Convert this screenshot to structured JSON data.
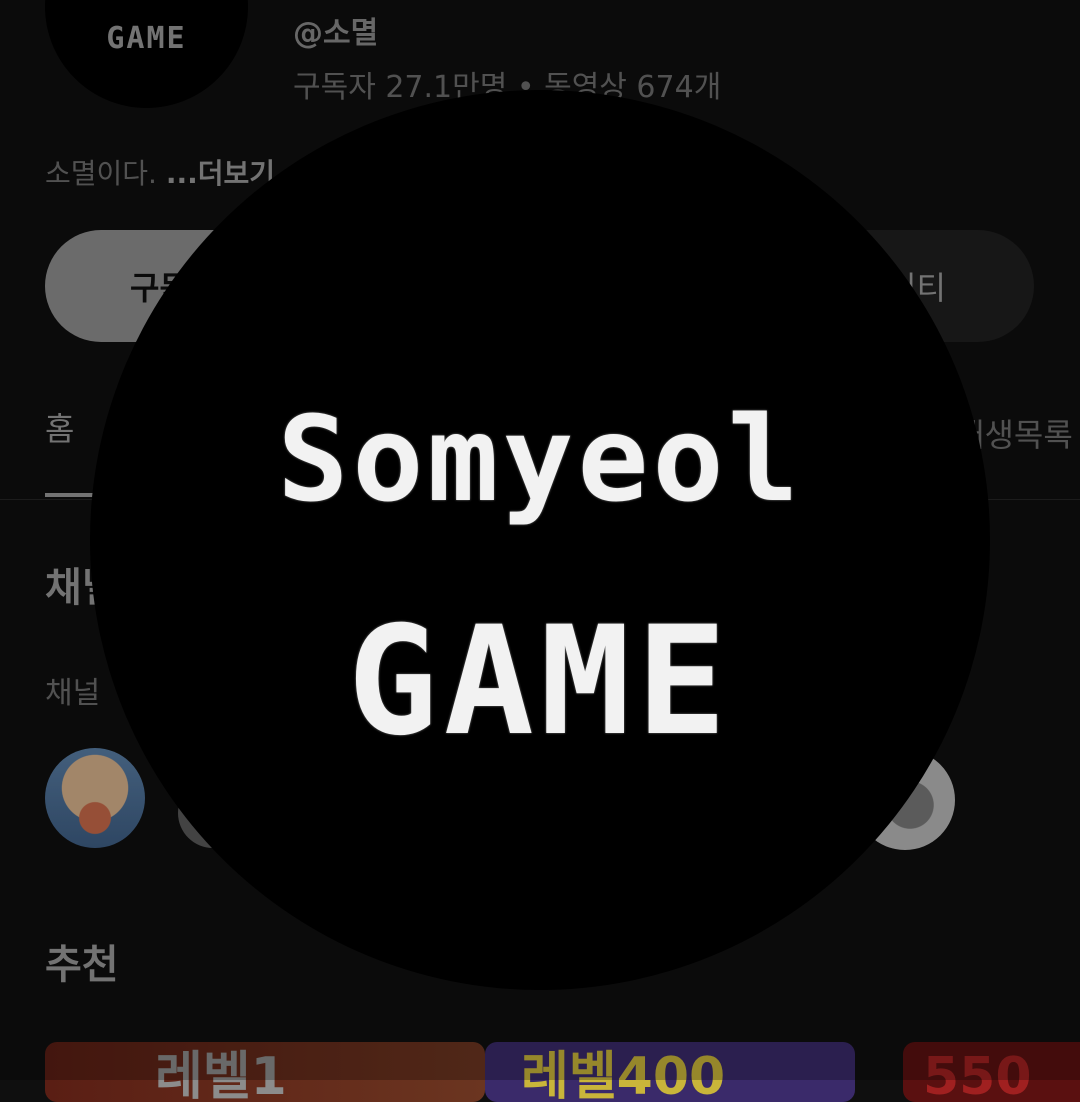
{
  "channel": {
    "avatar_text": "GAME",
    "handle": "@소멸",
    "meta": "구독자 27.1만명 • 동영상 674개",
    "description": "소멸이다.",
    "more": "...더보기"
  },
  "buttons": {
    "subscribe": "구독",
    "community": "커뮤니티"
  },
  "tabs": {
    "first": "홈",
    "last": "재생목록"
  },
  "sections": {
    "channels_title": "채널",
    "channels_subtitle": "채널",
    "recommended_title": "추천"
  },
  "thumbnails": [
    "레벨1",
    "레벨400",
    "550"
  ],
  "profile_preview": {
    "line1": "Somyeol",
    "line2": "GAME"
  }
}
